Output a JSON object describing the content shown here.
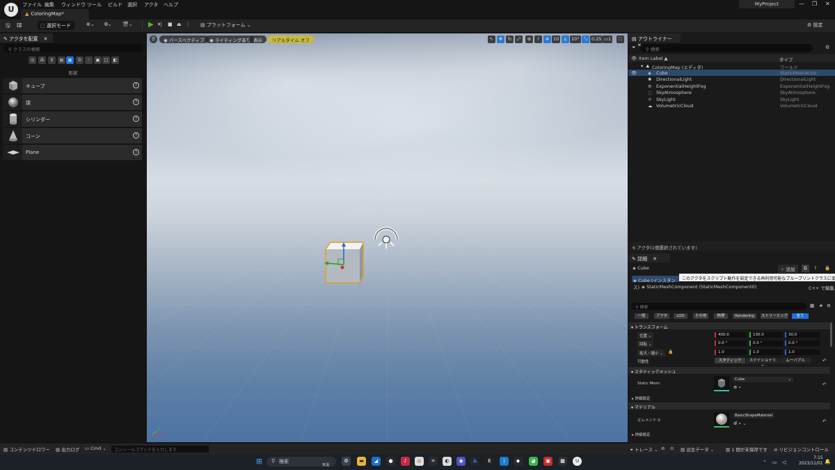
{
  "app": {
    "logo": "U",
    "doc_tab": "ColoringMap*",
    "project": "MyProject",
    "min": "—",
    "max": "❐",
    "close": "✕"
  },
  "menu": [
    "ファイル",
    "編集",
    "ウィンドウ",
    "ツール",
    "ビルド",
    "選択",
    "アクタ",
    "ヘルプ"
  ],
  "toolbar": {
    "mode": "選択モード",
    "platforms": "プラットフォーム",
    "settings": "設定"
  },
  "place_actors": {
    "tab": "アクタを配置",
    "search_placeholder": "クラスの検索",
    "category": "形状",
    "categories": [
      "◷",
      "⁂",
      "⚲",
      "▤",
      "▦",
      "D",
      "⁘",
      "▣",
      "□",
      "◧"
    ],
    "shapes": [
      "キューブ",
      "球",
      "シリンダー",
      "コーン",
      "Plane"
    ]
  },
  "viewport": {
    "perspective": "パースペクティブ",
    "lighting": "ライティングあり",
    "show": "表示",
    "realtime": "リアルタイム オフ",
    "grid": "10",
    "angle": "10°",
    "scale": "0.25",
    "cams": "1",
    "axis_z": "Z",
    "axis_x": "X",
    "axis_y": "Y"
  },
  "outliner": {
    "tab": "アウトライナー",
    "search_placeholder": "検索",
    "col_label": "Item Label ▲",
    "col_type": "タイプ",
    "rows": [
      {
        "name": "ColoringMap (エディタ)",
        "type": "ワールド"
      },
      {
        "name": "Cube",
        "type": "StaticMeshActor"
      },
      {
        "name": "DirectionalLight",
        "type": "DirectionalLight"
      },
      {
        "name": "ExponentialHeightFog",
        "type": "ExponentialHeightFog"
      },
      {
        "name": "SkyAtmosphere",
        "type": "SkyAtmosphere"
      },
      {
        "name": "SkyLight",
        "type": "SkyLight"
      },
      {
        "name": "VolumetricCloud",
        "type": "VolumetricCloud"
      }
    ],
    "footer": "6 アクタ(1個選択されています)"
  },
  "details": {
    "tab": "詳細",
    "actor_name": "Cube",
    "add": "追加",
    "instance": "Cube (インスタンス)",
    "tooltip": "このアクタをスクリプト動作を設定できる再利用可能なブループリントクラスに変換します",
    "component": "StaticMeshComponent (StaticMeshComponent0)",
    "cpp_edit": "C++ で編集",
    "search_placeholder": "検索",
    "filters": [
      "一般",
      "アクタ",
      "LOD",
      "その他",
      "物理",
      "Rendering",
      "ストリーミング",
      "全て"
    ],
    "transform": {
      "section": "トランスフォーム",
      "location": "位置",
      "rotation": "回転",
      "scale": "拡大・縮小",
      "loc": [
        "400.0",
        "130.0",
        "30.0"
      ],
      "rot": [
        "0.0 °",
        "0.0 °",
        "0.0 °"
      ],
      "scl": [
        "1.0",
        "1.0",
        "1.0"
      ],
      "mobility": "可動性",
      "mob_options": [
        "スタティック",
        "ステイショナリー",
        "ムーバブル"
      ]
    },
    "static_mesh": {
      "section": "スタティックメッシュ",
      "label": "Static Mesh",
      "value": "Cube",
      "advanced": "詳細設定"
    },
    "materials": {
      "section": "マテリアル",
      "label": "エレメント 0",
      "value": "BasicShapeMaterial",
      "advanced": "詳細設定"
    }
  },
  "bottom": {
    "content_drawer": "コンテンツドロワー",
    "output_log": "出力ログ",
    "cmd": "Cmd",
    "console_placeholder": "コンソールコマンドを入力します",
    "trace": "トレース",
    "derived": "派生データ",
    "unsaved": "1 個が未保存です",
    "source_control": "リビジョンコントロール"
  },
  "taskbar": {
    "search": "検索",
    "weather": "気温",
    "time": "7:15",
    "date": "2023/11/01"
  }
}
